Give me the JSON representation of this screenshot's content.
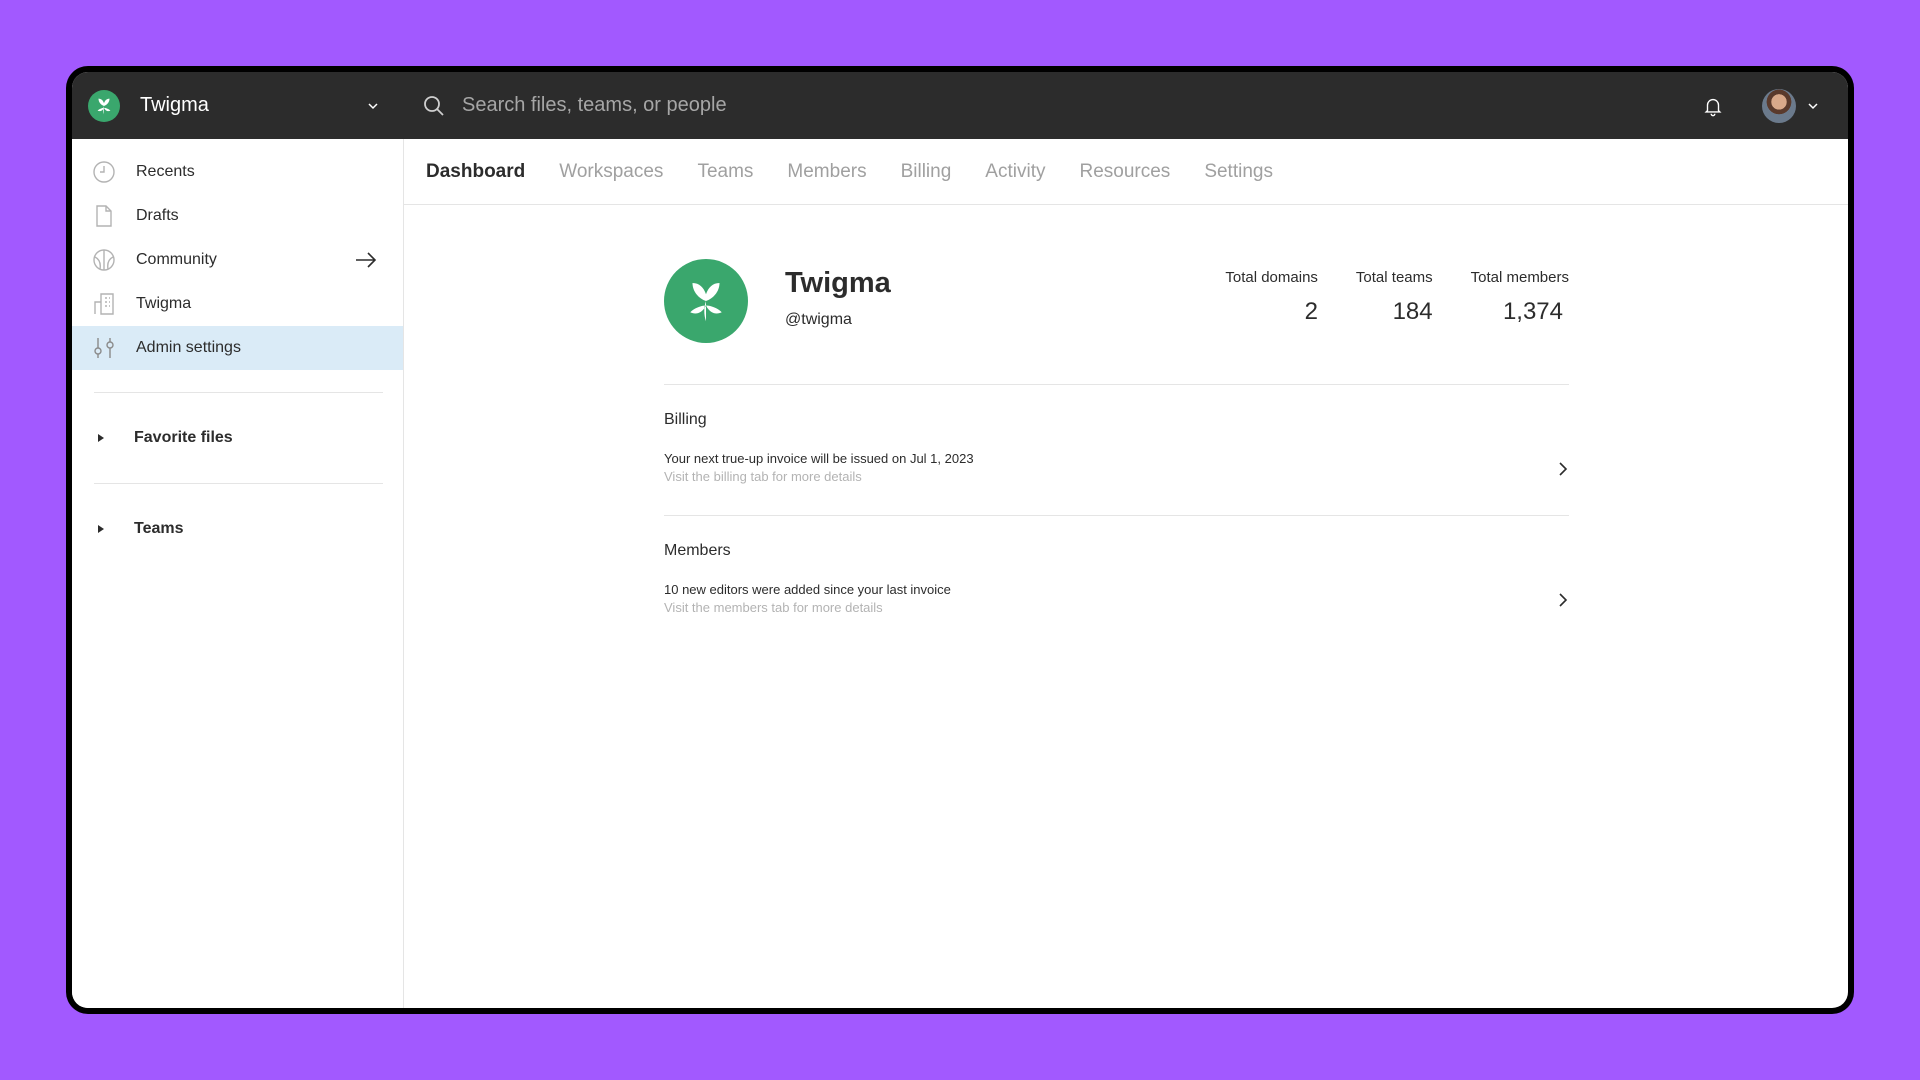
{
  "topbar": {
    "workspace_name": "Twigma",
    "search_placeholder": "Search files, teams, or people"
  },
  "sidebar": {
    "items": [
      {
        "label": "Recents",
        "icon": "clock-icon"
      },
      {
        "label": "Drafts",
        "icon": "file-icon"
      },
      {
        "label": "Community",
        "icon": "globe-icon"
      },
      {
        "label": "Twigma",
        "icon": "building-icon"
      },
      {
        "label": "Admin settings",
        "icon": "sliders-icon"
      }
    ],
    "active_item": "Admin settings",
    "sections": [
      {
        "label": "Favorite files"
      },
      {
        "label": "Teams"
      }
    ]
  },
  "tabs": [
    {
      "label": "Dashboard"
    },
    {
      "label": "Workspaces"
    },
    {
      "label": "Teams"
    },
    {
      "label": "Members"
    },
    {
      "label": "Billing"
    },
    {
      "label": "Activity"
    },
    {
      "label": "Resources"
    },
    {
      "label": "Settings"
    }
  ],
  "active_tab": "Dashboard",
  "org": {
    "name": "Twigma",
    "handle": "@twigma"
  },
  "stats": [
    {
      "label": "Total domains",
      "value": "2"
    },
    {
      "label": "Total teams",
      "value": "184"
    },
    {
      "label": "Total members",
      "value": "1,374"
    }
  ],
  "cards": [
    {
      "title": "Billing",
      "description": "Your next true-up invoice will be issued on Jul 1, 2023",
      "hint": "Visit the billing tab for more details"
    },
    {
      "title": "Members",
      "description": "10 new editors were added since your last invoice",
      "hint": "Visit the members tab for more details"
    }
  ],
  "colors": {
    "background": "#a259ff",
    "topbar": "#2c2c2c",
    "brand": "#3aa76d",
    "active_nav": "#daebf7"
  }
}
